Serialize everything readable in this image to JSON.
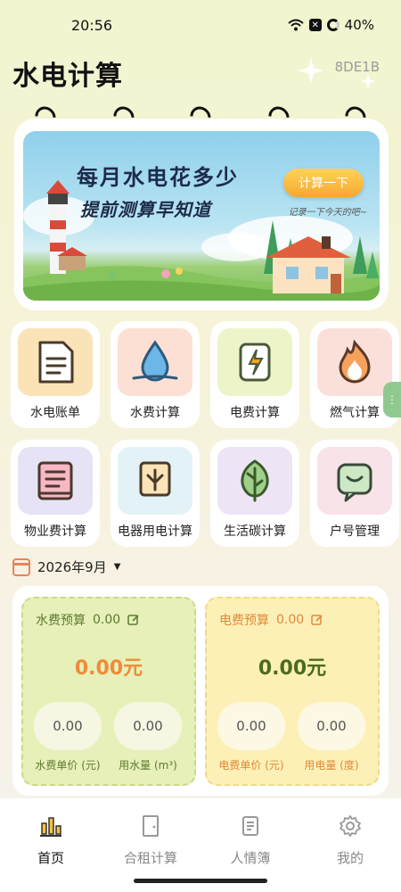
{
  "status_bar": {
    "time": "20:56",
    "battery": "40%"
  },
  "header": {
    "title": "水电计算",
    "code": "8DE1B"
  },
  "banner": {
    "title": "每月水电花多少",
    "subtitle": "提前测算早知道",
    "button_label": "计算一下",
    "note": "记录一下今天的吧~"
  },
  "tiles": [
    {
      "label": "水电账单",
      "icon": "bill-document-icon",
      "color": "#fbe3b8"
    },
    {
      "label": "水费计算",
      "icon": "water-drop-icon",
      "color": "#fde0d4"
    },
    {
      "label": "电费计算",
      "icon": "battery-lightning-icon",
      "color": "#eef4c9"
    },
    {
      "label": "燃气计算",
      "icon": "flame-icon",
      "color": "#fbe0d9"
    },
    {
      "label": "物业费计算",
      "icon": "notebook-icon",
      "color": "#e7e3f6"
    },
    {
      "label": "电器用电计算",
      "icon": "appliance-plug-icon",
      "color": "#e3f2f6"
    },
    {
      "label": "生活碳计算",
      "icon": "leaf-icon",
      "color": "#ede4f6"
    },
    {
      "label": "户号管理",
      "icon": "chat-card-icon",
      "color": "#f7e3e8"
    }
  ],
  "month": {
    "label": "2026年9月"
  },
  "water_budget": {
    "title": "水费预算",
    "budget_value": "0.00",
    "amount": "0.00元",
    "unit_price_value": "0.00",
    "unit_price_label": "水费单价 (元)",
    "usage_value": "0.00",
    "usage_label": "用水量 (m³)"
  },
  "electric_budget": {
    "title": "电费预算",
    "budget_value": "0.00",
    "amount": "0.00元",
    "unit_price_value": "0.00",
    "unit_price_label": "电费单价 (元)",
    "usage_value": "0.00",
    "usage_label": "用电量 (度)"
  },
  "nav": [
    {
      "label": "首页",
      "icon": "bar-chart-icon",
      "active": true
    },
    {
      "label": "合租计算",
      "icon": "door-icon",
      "active": false
    },
    {
      "label": "人情簿",
      "icon": "notebook-icon",
      "active": false
    },
    {
      "label": "我的",
      "icon": "gear-icon",
      "active": false
    }
  ],
  "colors": {
    "accent_orange": "#f0883a",
    "water_amount": "#ef8b3a",
    "elec_amount": "#4d6b1e",
    "water_label": "#5e7a2e",
    "elec_label": "#e0893c"
  }
}
